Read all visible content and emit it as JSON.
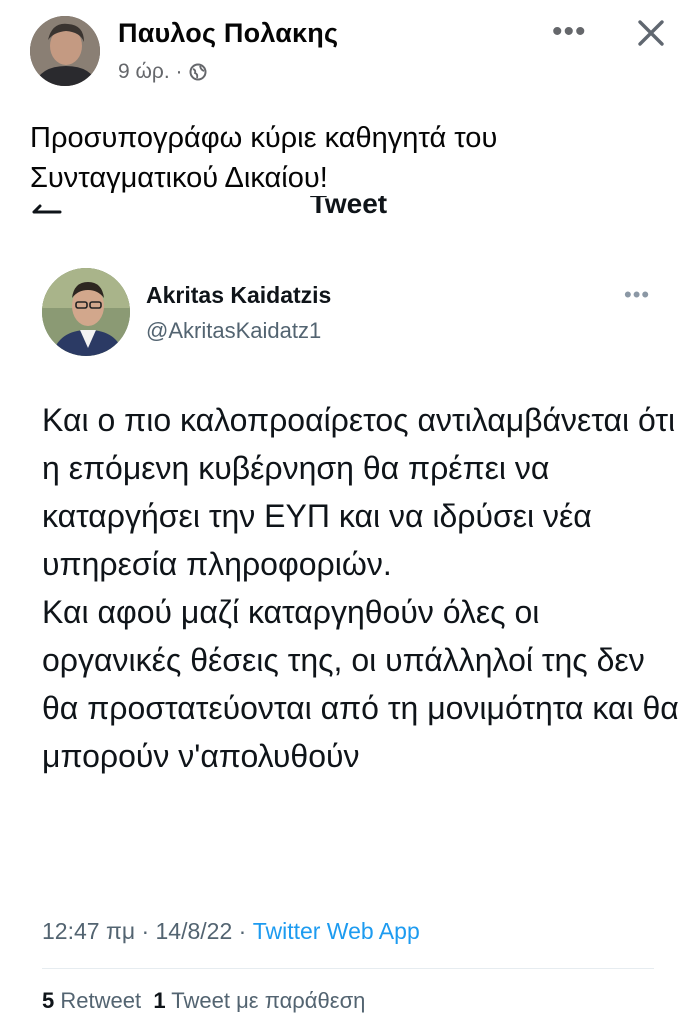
{
  "post": {
    "author": "Παυλος Πολακης",
    "time": "9 ώρ. ·",
    "text": "Προσυπογράφω κύριε καθηγητά του Συνταγματικού Δικαίου!",
    "icons": {
      "more": "more-horizontal-icon",
      "close": "close-icon",
      "audience": "globe-icon"
    }
  },
  "tweet": {
    "topbar_title": "Tweet",
    "author_name": "Akritas Kaidatzis",
    "handle": "@AkritasKaidatz1",
    "text": "Και ο πιο καλοπροαίρετος αντιλαμβάνεται ότι η επόμενη κυβέρνηση θα πρέπει να καταργήσει την ΕΥΠ και να ιδρύσει νέα υπηρεσία πληροφοριών.\nΚαι αφού μαζί καταργηθούν όλες οι οργανικές θέσεις της, οι υπάλληλοί της δεν θα προστατεύονται από τη μονιμότητα και θα μπορούν ν'απολυθούν",
    "timestamp": "12:47 πμ · 14/8/22 · ",
    "source": "Twitter Web App",
    "retweet_count": "5",
    "retweet_label": "Retweet",
    "quote_count": "1",
    "quote_label": "Tweet με παράθεση"
  },
  "colors": {
    "link": "#1d9bf0",
    "secondary": "#65676b",
    "twitter_secondary": "#536471"
  }
}
